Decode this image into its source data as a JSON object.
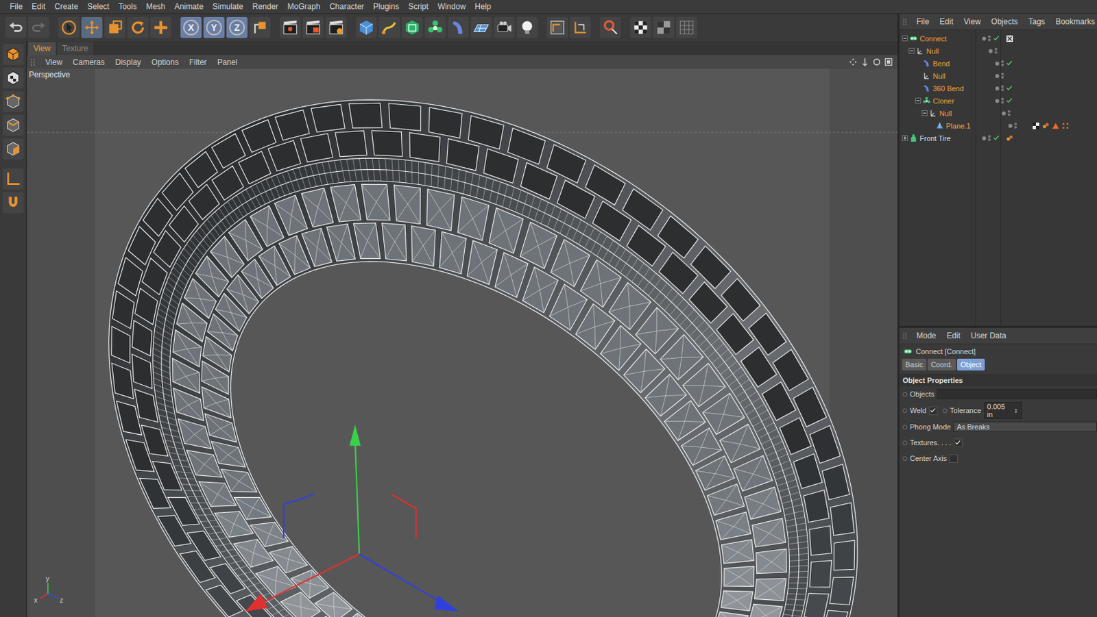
{
  "menubar": [
    "File",
    "Edit",
    "Create",
    "Select",
    "Tools",
    "Mesh",
    "Animate",
    "Simulate",
    "Render",
    "MoGraph",
    "Character",
    "Plugins",
    "Script",
    "Window",
    "Help"
  ],
  "toolbar": {
    "axis_lock": [
      {
        "label": "X",
        "on": true
      },
      {
        "label": "Y",
        "on": true
      },
      {
        "label": "Z",
        "on": true
      }
    ]
  },
  "viewport": {
    "tabs": [
      {
        "label": "View",
        "selected": true
      },
      {
        "label": "Texture",
        "selected": false
      }
    ],
    "menu": [
      "View",
      "Cameras",
      "Display",
      "Options",
      "Filter",
      "Panel"
    ],
    "camera": "Perspective",
    "mini_axis": {
      "x": "x",
      "y": "y",
      "z": "z"
    }
  },
  "object_manager": {
    "menu": [
      "File",
      "Edit",
      "View",
      "Objects",
      "Tags",
      "Bookmarks"
    ],
    "objects": [
      {
        "name": "Connect",
        "depth": 0,
        "kind": "connect",
        "expanded": true,
        "selected": true,
        "checked": true,
        "tags": [
          {
            "kind": "close"
          }
        ]
      },
      {
        "name": "Null",
        "depth": 1,
        "kind": "null",
        "expanded": true,
        "selected": true,
        "checked": false,
        "tags": []
      },
      {
        "name": "Bend",
        "depth": 2,
        "kind": "deformer",
        "selected": true,
        "checked": true,
        "tags": []
      },
      {
        "name": "Null",
        "depth": 2,
        "kind": "null",
        "selected": true,
        "checked": false,
        "tags": []
      },
      {
        "name": "360 Bend",
        "depth": 2,
        "kind": "deformer",
        "selected": true,
        "checked": true,
        "tags": []
      },
      {
        "name": "Cloner",
        "depth": 2,
        "kind": "cloner",
        "expanded": true,
        "selected": true,
        "checked": true,
        "tags": []
      },
      {
        "name": "Null",
        "depth": 3,
        "kind": "null",
        "expanded": true,
        "selected": true,
        "checked": false,
        "tags": []
      },
      {
        "name": "Plane.1",
        "depth": 4,
        "kind": "polygon",
        "selected": true,
        "checked": false,
        "tags": [
          {
            "kind": "texture"
          },
          {
            "kind": "phong"
          },
          {
            "kind": "warning"
          },
          {
            "kind": "selection"
          }
        ]
      },
      {
        "name": "Front Tire",
        "depth": 0,
        "kind": "object",
        "expanded": false,
        "selected": false,
        "checked": true,
        "tags": [
          {
            "kind": "phong"
          }
        ]
      }
    ]
  },
  "attribute_manager": {
    "menu": [
      "Mode",
      "Edit",
      "User Data"
    ],
    "title": "Connect [Connect]",
    "tabs": [
      {
        "label": "Basic",
        "selected": false
      },
      {
        "label": "Coord.",
        "selected": false
      },
      {
        "label": "Object",
        "selected": true
      }
    ],
    "section": "Object Properties",
    "rows": [
      [
        {
          "kind": "link",
          "label": "Objects",
          "value": ""
        }
      ],
      [
        {
          "kind": "checkbox",
          "label": "Weld",
          "checked": true
        },
        {
          "kind": "number",
          "label": "Tolerance",
          "value": "0.005 in"
        }
      ],
      [
        {
          "kind": "dropdown",
          "label": "Phong Mode",
          "value": "As Breaks"
        }
      ],
      [
        {
          "kind": "checkbox",
          "label": "Textures. . . .",
          "checked": true
        }
      ],
      [
        {
          "kind": "checkbox",
          "label": "Center Axis",
          "checked": false
        }
      ]
    ]
  }
}
